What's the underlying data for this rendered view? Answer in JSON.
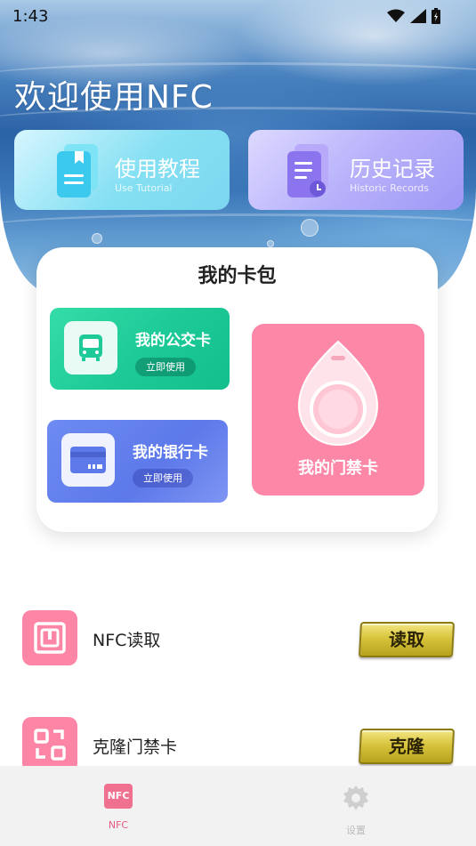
{
  "status_bar": {
    "time": "1:43"
  },
  "header": {
    "welcome": "欢迎使用NFC"
  },
  "top_cards": {
    "tutorial": {
      "title": "使用教程",
      "subtitle": "Use Tutorial"
    },
    "history": {
      "title": "历史记录",
      "subtitle": "Historic Records"
    }
  },
  "wallet": {
    "title": "我的卡包",
    "bus_card": {
      "label": "我的公交卡",
      "button": "立即使用"
    },
    "bank_card": {
      "label": "我的银行卡",
      "button": "立即使用"
    },
    "door_card": {
      "label": "我的门禁卡"
    }
  },
  "functions": [
    {
      "label": "NFC读取",
      "button": "读取"
    },
    {
      "label": "克隆门禁卡",
      "button": "克隆"
    }
  ],
  "bottom_nav": {
    "nfc": {
      "badge": "NFC",
      "label": "NFC"
    },
    "settings": {
      "label": "设置"
    }
  },
  "colors": {
    "accent_pink": "#fd87a7",
    "bus_green": "#1ecb98",
    "bank_blue": "#5d79ea",
    "gold": "#d8c43c"
  }
}
